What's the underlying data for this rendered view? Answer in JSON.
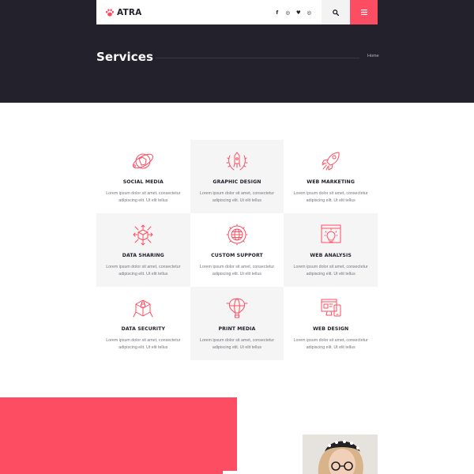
{
  "brand": {
    "name": "ATRA",
    "logo_icon": "paw-icon"
  },
  "nav": {
    "socials": [
      {
        "name": "facebook-icon",
        "glyph": "f"
      },
      {
        "name": "instagram-icon",
        "glyph": "◎"
      },
      {
        "name": "twitter-icon",
        "glyph": "♥"
      },
      {
        "name": "dribbble-icon",
        "glyph": "◎"
      }
    ],
    "search_icon": "search-icon",
    "menu_icon": "menu-icon"
  },
  "page": {
    "title": "Services",
    "breadcrumb": "Home"
  },
  "services": [
    {
      "title": "SOCIAL MEDIA",
      "text": "Lorem ipsum dolor sit amet, consectetur adipiscing elit. Ut elit tellus",
      "icon": "social-media-icon"
    },
    {
      "title": "GRAPHIC DESIGN",
      "text": "Lorem ipsum dolor sit amet, consectetur adipiscing elit. Ut elit tellus",
      "icon": "graphic-design-icon"
    },
    {
      "title": "WEB MARKETING",
      "text": "Lorem ipsum dolor sit amet, consectetur adipiscing elit. Ut elit tellus",
      "icon": "rocket-icon"
    },
    {
      "title": "DATA SHARING",
      "text": "Lorem ipsum dolor sit amet, consectetur adipiscing elit. Ut elit tellus",
      "icon": "data-sharing-icon"
    },
    {
      "title": "CUSTOM SUPPORT",
      "text": "Lorem ipsum dolor sit amet, consectetur adipiscing elit. Ut elit tellus",
      "icon": "globe-gear-icon"
    },
    {
      "title": "WEB ANALYSIS",
      "text": "Lorem ipsum dolor sit amet, consectetur adipiscing elit. Ut elit tellus",
      "icon": "web-analysis-icon"
    },
    {
      "title": "DATA SECURITY",
      "text": "Lorem ipsum dolor sit amet, consectetur adipiscing elit. Ut elit tellus",
      "icon": "data-security-icon"
    },
    {
      "title": "PRINT MEDIA",
      "text": "Lorem ipsum dolor sit amet, consectetur adipiscing elit. Ut elit tellus",
      "icon": "hot-air-balloon-icon"
    },
    {
      "title": "WEB DESIGN",
      "text": "Lorem ipsum dolor sit amet, consectetur adipiscing elit. Ut elit tellus",
      "icon": "web-design-icon"
    }
  ],
  "colors": {
    "accent": "#fd4d62",
    "dark": "#23212b",
    "card_shade": "#f5f5f5",
    "body_text": "#77757e"
  }
}
